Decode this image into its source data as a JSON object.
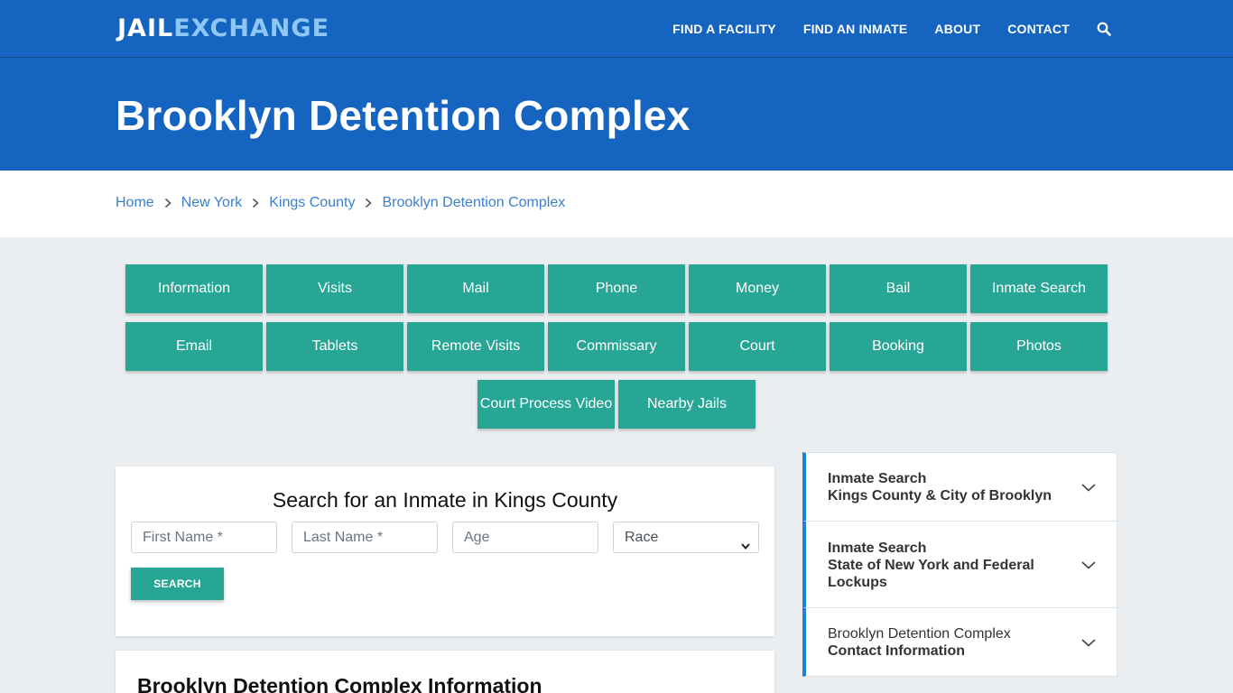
{
  "brand": {
    "part1": "JAIL",
    "part2": "EXCHANGE",
    "color_primary": "#1565c0",
    "color_accent": "#27a696"
  },
  "nav": {
    "items": [
      "FIND A FACILITY",
      "FIND AN INMATE",
      "ABOUT",
      "CONTACT"
    ],
    "search_icon": "search-icon"
  },
  "hero": {
    "title": "Brooklyn Detention Complex"
  },
  "breadcrumb": [
    "Home",
    "New York",
    "Kings County",
    "Brooklyn Detention Complex"
  ],
  "tiles": [
    "Information",
    "Visits",
    "Mail",
    "Phone",
    "Money",
    "Bail",
    "Inmate Search",
    "Email",
    "Tablets",
    "Remote Visits",
    "Commissary",
    "Court",
    "Booking",
    "Photos",
    "Court Process Video",
    "Nearby Jails"
  ],
  "search": {
    "title": "Search for an Inmate in Kings County",
    "first_name_placeholder": "First Name *",
    "last_name_placeholder": "Last Name *",
    "age_placeholder": "Age",
    "race_selected": "Race",
    "button": "SEARCH"
  },
  "info": {
    "title": "Brooklyn Detention Complex Information"
  },
  "sidebar": [
    {
      "line1": "Inmate Search",
      "line2": "Kings County & City of Brooklyn"
    },
    {
      "line1": "Inmate Search",
      "line2": "State of New York and Federal",
      "line3": "Lockups"
    },
    {
      "line1": "Brooklyn Detention Complex",
      "line2": "Contact Information"
    }
  ]
}
